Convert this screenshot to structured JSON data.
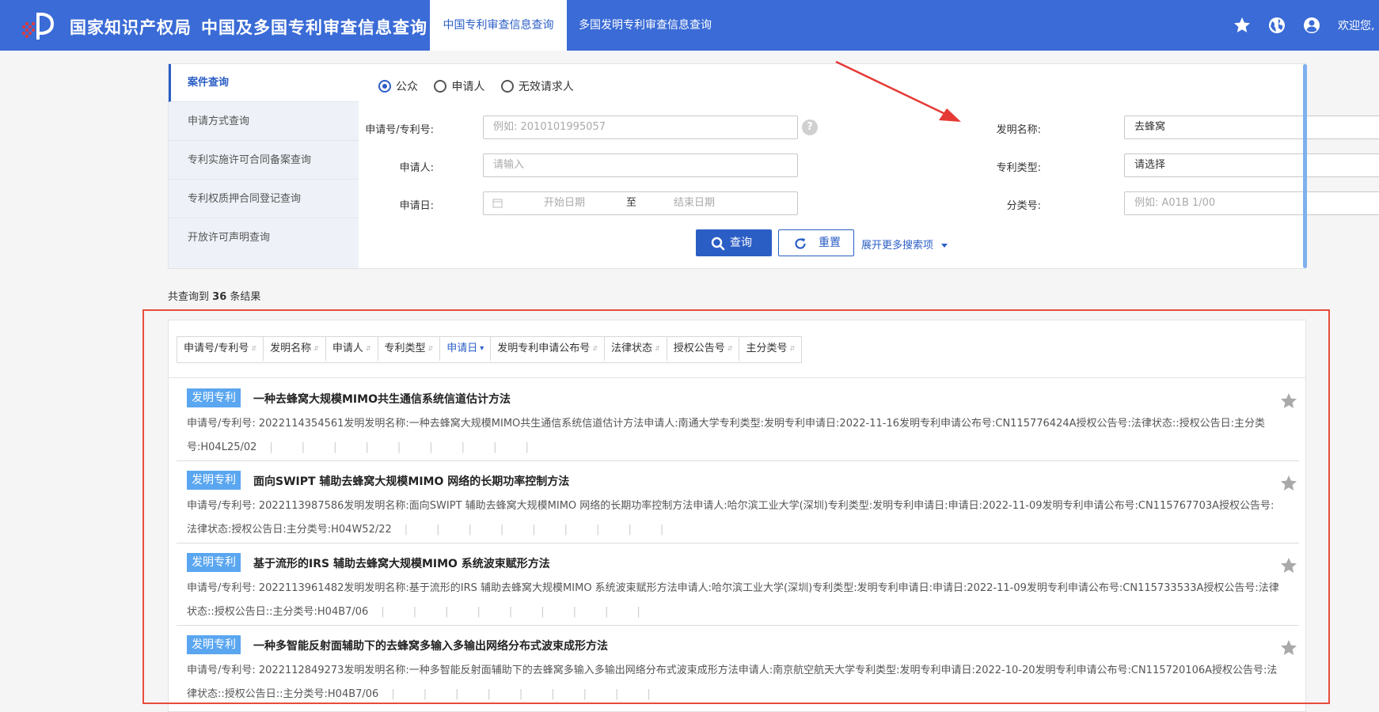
{
  "header": {
    "org_name": "国家知识产权局",
    "site_name": "中国及多国专利审查信息查询",
    "tabs": [
      "中国专利审查信息查询",
      "多国发明专利审查信息查询"
    ],
    "welcome": "欢迎您,",
    "icons": [
      "star-icon",
      "globe-icon",
      "user-icon"
    ],
    "brand_color": "#3a6bd6"
  },
  "side_menu": [
    "案件查询",
    "申请方式查询",
    "专利实施许可合同备案查询",
    "专利权质押合同登记查询",
    "开放许可声明查询"
  ],
  "search": {
    "roles": [
      {
        "label": "公众",
        "selected": true
      },
      {
        "label": "申请人",
        "selected": false
      },
      {
        "label": "无效请求人",
        "selected": false
      }
    ],
    "app_no_label": "申请号/专利号:",
    "app_no_placeholder": "例如: 2010101995057",
    "applicant_label": "申请人:",
    "applicant_placeholder": "请输入",
    "date_label": "申请日:",
    "date_start": "开始日期",
    "date_to": "至",
    "date_end": "结束日期",
    "invention_label": "发明名称:",
    "invention_value": "去蜂窝",
    "type_label": "专利类型:",
    "type_value": "请选择",
    "class_label": "分类号:",
    "class_placeholder": "例如:  A01B 1/00",
    "query_btn": "查询",
    "reset_btn": "重置",
    "more_link": "展开更多搜索项"
  },
  "results": {
    "count_prefix": "共查询到",
    "count": "36",
    "count_suffix": "条结果",
    "sort_columns": [
      {
        "label": "申请号/专利号",
        "active": false
      },
      {
        "label": "发明名称",
        "active": false
      },
      {
        "label": "申请人",
        "active": false
      },
      {
        "label": "专利类型",
        "active": false
      },
      {
        "label": "申请日",
        "active": true
      },
      {
        "label": "发明专利申请公布号",
        "active": false
      },
      {
        "label": "法律状态",
        "active": false
      },
      {
        "label": "授权公告号",
        "active": false
      },
      {
        "label": "主分类号",
        "active": false
      }
    ],
    "items": [
      {
        "tag": "发明专利",
        "title": "一种去蜂窝大规模MIMO共生通信系统信道估计方法",
        "desc": "申请号/专利号:  2022114354561发明发明名称:一种去蜂窝大规模MIMO共生通信系统信道估计方法申请人:南通大学专利类型:发明专利申请日:2022-11-16发明专利申请公布号:CN115776424A授权公告号:法律状态::授权公告日:主分类号:H04L25/02"
      },
      {
        "tag": "发明专利",
        "title": "面向SWIPT 辅助去蜂窝大规模MIMO 网络的长期功率控制方法",
        "desc": "申请号/专利号:  2022113987586发明发明名称:面向SWIPT 辅助去蜂窝大规模MIMO 网络的长期功率控制方法申请人:哈尔滨工业大学(深圳)专利类型:发明专利申请日:申请日:2022-11-09发明专利申请公布号:CN115767703A授权公告号:法律状态:授权公告日:主分类号:H04W52/22"
      },
      {
        "tag": "发明专利",
        "title": "基于流形的IRS 辅助去蜂窝大规模MIMO 系统波束赋形方法",
        "desc": "申请号/专利号:  2022113961482发明发明名称:基于流形的IRS 辅助去蜂窝大规模MIMO 系统波束赋形方法申请人:哈尔滨工业大学(深圳)专利类型:发明专利申请日:申请日:2022-11-09发明专利申请公布号:CN115733533A授权公告号:法律状态::授权公告日::主分类号:H04B7/06"
      },
      {
        "tag": "发明专利",
        "title": "一种多智能反射面辅助下的去蜂窝多输入多输出网络分布式波束成形方法",
        "desc": "申请号/专利号:  2022112849273发明发明名称:一种多智能反射面辅助下的去蜂窝多输入多输出网络分布式波束成形方法申请人:南京航空航天大学专利类型:发明专利申请日:2022-10-20发明专利申请公布号:CN115720106A授权公告号:法律状态::授权公告日::主分类号:H04B7/06"
      }
    ]
  },
  "annotation_colors": {
    "arrow": "#e53935",
    "box": "#e74c3c"
  }
}
